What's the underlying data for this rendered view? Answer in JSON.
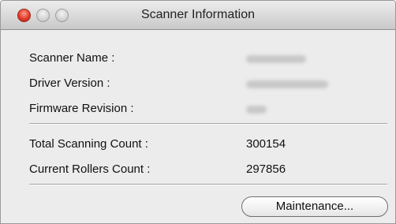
{
  "window": {
    "title": "Scanner Information"
  },
  "info": {
    "rows": [
      {
        "label": "Scanner Name :",
        "value": ""
      },
      {
        "label": "Driver Version :",
        "value": ""
      },
      {
        "label": "Firmware Revision :",
        "value": ""
      }
    ],
    "counts": [
      {
        "label": "Total Scanning Count :",
        "value": "300154"
      },
      {
        "label": "Current Rollers Count :",
        "value": "297856"
      }
    ]
  },
  "actions": {
    "maintenance_label": "Maintenance..."
  },
  "icons": {
    "close": "close-icon",
    "minimize": "minimize-icon",
    "zoom": "zoom-icon"
  },
  "colors": {
    "close_button": "#e33c2a",
    "window_background": "#ececec"
  }
}
